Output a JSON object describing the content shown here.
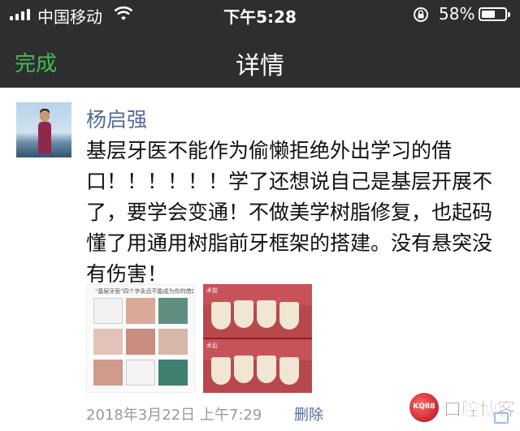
{
  "status_bar": {
    "carrier": "中国移动",
    "time": "下午5:28",
    "battery_percent": "58%",
    "battery_level": 0.58
  },
  "nav": {
    "done_label": "完成",
    "title": "详情"
  },
  "post": {
    "author": "杨启强",
    "content": "基层牙医不能作为偷懒拒绝外出学习的借口！！！！！！学了还想说自己是基层开展不了，要学会变通！不做美学树脂修复，也起码懂了用通用树脂前牙框架的搭建。没有悬突没有伤害！",
    "images": [
      {
        "caption": "\"基层牙医\"四个字永远不能成为你的借口!"
      },
      {
        "caption_top": "术前",
        "caption_bottom": "术后"
      }
    ],
    "date": "2018年3月22日 上午7:29",
    "delete_label": "删除"
  },
  "watermark": {
    "badge": "KQ88",
    "text": "口腔博客"
  },
  "colors": {
    "header_bg": "#2e2e31",
    "accent_green": "#3fc04a",
    "link_blue": "#576b95"
  }
}
